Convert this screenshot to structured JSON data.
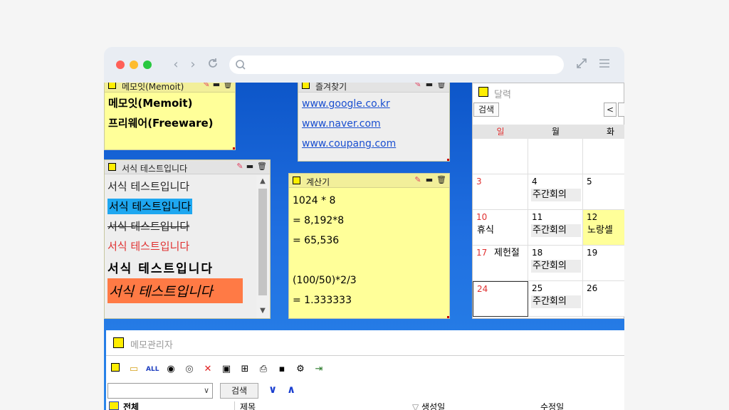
{
  "browser": {
    "url": ""
  },
  "notes": {
    "memoit": {
      "title": "메모잇(Memoit)",
      "lines": [
        "메모잇(Memoit)",
        "프리웨어(Freeware)"
      ]
    },
    "favorites": {
      "title": "즐겨찾기",
      "links": [
        "www.google.co.kr",
        "www.naver.com",
        "www.coupang.com"
      ]
    },
    "format": {
      "title": "서식 테스트입니다",
      "lines": [
        "서식 테스트입니다",
        "서식 테스트입니다",
        "서식 테스트입니다",
        "서식 테스트입니다",
        "서식 테스트입니다",
        "서식 테스트입니다"
      ]
    },
    "calc": {
      "title": "계산기",
      "lines": [
        "1024 * 8",
        "= 8,192*8",
        "= 65,536",
        "",
        "(100/50)*2/3",
        "= 1.333333"
      ]
    }
  },
  "calendar": {
    "title": "달력",
    "search_label": "검색",
    "prev_label": "<",
    "days": [
      "일",
      "월",
      "화"
    ],
    "rows": [
      [
        {
          "num": "",
          "evt": ""
        },
        {
          "num": "",
          "evt": ""
        },
        {
          "num": "",
          "evt": ""
        }
      ],
      [
        {
          "num": "3",
          "evt": ""
        },
        {
          "num": "4",
          "evt": "주간회의"
        },
        {
          "num": "5",
          "evt": ""
        }
      ],
      [
        {
          "num": "10",
          "evt": "휴식"
        },
        {
          "num": "11",
          "evt": "주간회의"
        },
        {
          "num": "12",
          "evt": "노랑셀"
        }
      ],
      [
        {
          "num": "17",
          "evt": "제헌절"
        },
        {
          "num": "18",
          "evt": "주간회의"
        },
        {
          "num": "19",
          "evt": ""
        }
      ],
      [
        {
          "num": "24",
          "evt": ""
        },
        {
          "num": "25",
          "evt": "주간회의"
        },
        {
          "num": "26",
          "evt": ""
        }
      ]
    ]
  },
  "manager": {
    "title": "메모관리자",
    "search_label": "검색",
    "tree_root": "전체",
    "col_title": "제목",
    "col_created": "생성일",
    "col_modified": "수정일"
  },
  "colors": {
    "sunday": "#e03030",
    "note_yellow": "#ffff99",
    "highlight_blue": "#1ea7f0",
    "highlight_orange": "#ff7a45"
  }
}
